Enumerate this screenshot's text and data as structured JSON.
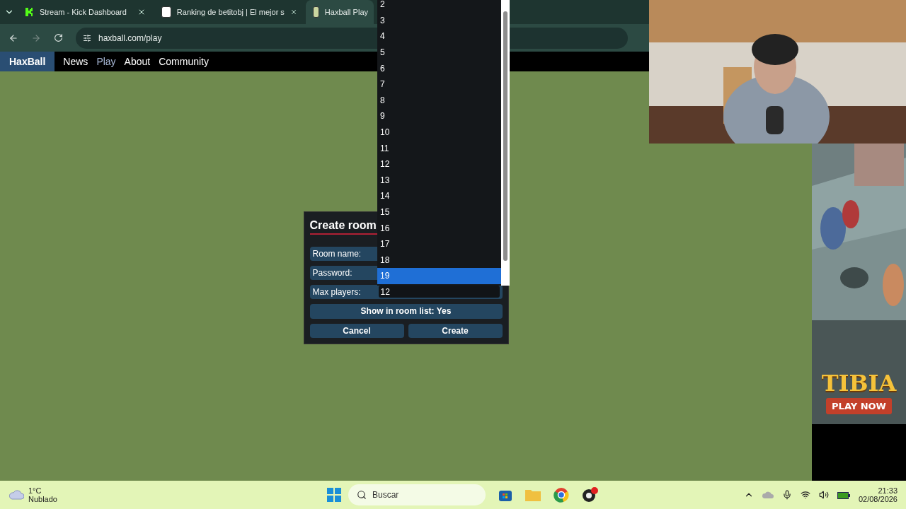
{
  "browser": {
    "tabs": [
      {
        "title": "Stream - Kick Dashboard",
        "selected": false
      },
      {
        "title": "Ranking de betitobj | El mejor s",
        "selected": false
      },
      {
        "title": "Haxball Play",
        "selected": true
      }
    ],
    "url": "haxball.com/play"
  },
  "site_nav": {
    "logo": "HaxBall",
    "items": [
      {
        "label": "News",
        "selected": false
      },
      {
        "label": "Play",
        "selected": true
      },
      {
        "label": "About",
        "selected": false
      },
      {
        "label": "Community",
        "selected": false
      }
    ]
  },
  "dialog": {
    "title": "Create room",
    "fields": [
      {
        "label": "Room name:"
      },
      {
        "label": "Password:"
      },
      {
        "label": "Max players:",
        "value": "12"
      }
    ],
    "toggle": "Show in room list: Yes",
    "buttons": [
      "Cancel",
      "Create"
    ]
  },
  "dropdown": {
    "options": [
      {
        "label": "2",
        "selected": false
      },
      {
        "label": "3",
        "selected": false
      },
      {
        "label": "4",
        "selected": false
      },
      {
        "label": "5",
        "selected": false
      },
      {
        "label": "6",
        "selected": false
      },
      {
        "label": "7",
        "selected": false
      },
      {
        "label": "8",
        "selected": false
      },
      {
        "label": "9",
        "selected": false
      },
      {
        "label": "10",
        "selected": false
      },
      {
        "label": "11",
        "selected": false
      },
      {
        "label": "12",
        "selected": false
      },
      {
        "label": "13",
        "selected": false
      },
      {
        "label": "14",
        "selected": false
      },
      {
        "label": "15",
        "selected": false
      },
      {
        "label": "16",
        "selected": false
      },
      {
        "label": "17",
        "selected": false
      },
      {
        "label": "18",
        "selected": false
      },
      {
        "label": "19",
        "selected": true
      }
    ]
  },
  "ad": {
    "kind": "picture",
    "logo": "TIBIA",
    "button": "PLAY NOW"
  },
  "taskbar": {
    "weather": {
      "temp": "1°C",
      "condition": "Nublado"
    },
    "search_placeholder": "Buscar",
    "time": "21:33",
    "date": "02/08/2026"
  }
}
